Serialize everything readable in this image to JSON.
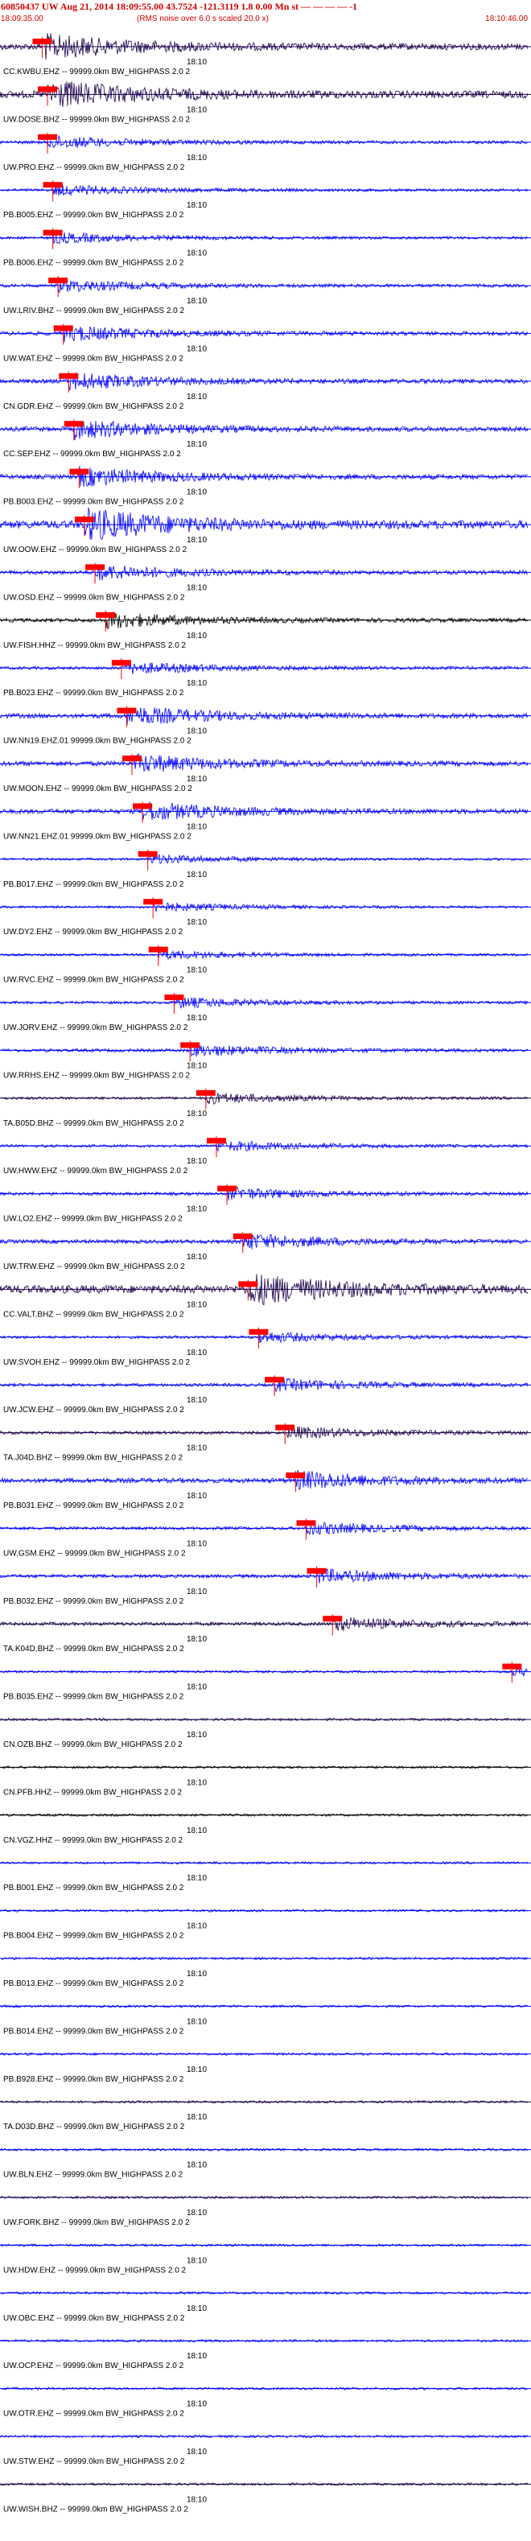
{
  "header": {
    "title": "60850437 UW Aug 21, 2014 18:09:55.00   43.7524 -121.3119   1.8 0.00 Mn st  — — — —   -1",
    "start_time": "18:09:35.00",
    "note": "(RMS noise over 6.0 s scaled 20.0 x)",
    "end_time": "18:10:46.00"
  },
  "colors": {
    "trace_blue": "#0000ff",
    "trace_dark": "#1a004a",
    "trace_black": "#000000",
    "pick_red": "#ff0000",
    "header_red": "#d40000"
  },
  "chart_data": {
    "type": "seismogram",
    "time_label": "18:10",
    "channels": [
      {
        "label": "CC.KWBU.EHZ -- 99999.0km BW_HIGHPASS  2.0  2",
        "color": "#1a004a",
        "pick": 0.08,
        "amp": 0.8
      },
      {
        "label": "UW.DOSE.BHZ -- 99999.0km BW_HIGHPASS  2.0  2",
        "color": "#1a004a",
        "pick": 0.09,
        "amp": 0.9
      },
      {
        "label": "UW.PRO.EHZ -- 99999.0km BW_HIGHPASS  2.0  2",
        "color": "#0000ff",
        "pick": 0.09,
        "amp": 0.4
      },
      {
        "label": "PB.B005.EHZ -- 99999.0km BW_HIGHPASS  2.0  2",
        "color": "#0000ff",
        "pick": 0.1,
        "amp": 0.35
      },
      {
        "label": "PB.B006.EHZ -- 99999.0km BW_HIGHPASS  2.0  2",
        "color": "#0000ff",
        "pick": 0.1,
        "amp": 0.35
      },
      {
        "label": "UW.LRIV.BHZ -- 99999.0km BW_HIGHPASS  2.0  2",
        "color": "#0000ff",
        "pick": 0.11,
        "amp": 0.4
      },
      {
        "label": "UW.WAT.EHZ -- 99999.0km BW_HIGHPASS  2.0  2",
        "color": "#0000ff",
        "pick": 0.12,
        "amp": 0.5
      },
      {
        "label": "CN.GDR.EHZ -- 99999.0km BW_HIGHPASS  2.0  2",
        "color": "#0000ff",
        "pick": 0.13,
        "amp": 0.55
      },
      {
        "label": "CC.SEP.EHZ -- 99999.0km BW_HIGHPASS  2.0  2",
        "color": "#0000ff",
        "pick": 0.14,
        "amp": 0.6
      },
      {
        "label": "PB.B003.EHZ -- 99999.0km BW_HIGHPASS  2.0  2",
        "color": "#0000ff",
        "pick": 0.15,
        "amp": 0.6
      },
      {
        "label": "UW.OOW.EHZ -- 99999.0km BW_HIGHPASS  2.0  2",
        "color": "#0000ff",
        "pick": 0.16,
        "amp": 1.0
      },
      {
        "label": "UW.OSD.EHZ -- 99999.0km BW_HIGHPASS  2.0  2",
        "color": "#0000ff",
        "pick": 0.18,
        "amp": 0.5
      },
      {
        "label": "UW.FISH.HHZ -- 99999.0km BW_HIGHPASS  2.0  2",
        "color": "#000000",
        "pick": 0.2,
        "amp": 0.5
      },
      {
        "label": "PB.B023.EHZ -- 99999.0km BW_HIGHPASS  2.0  2",
        "color": "#0000ff",
        "pick": 0.23,
        "amp": 0.4
      },
      {
        "label": "UW.NN19.EHZ.01 99999.0km BW_HIGHPASS  2.0  2",
        "color": "#0000ff",
        "pick": 0.24,
        "amp": 0.6
      },
      {
        "label": "UW.MOON.EHZ -- 99999.0km BW_HIGHPASS  2.0  2",
        "color": "#0000ff",
        "pick": 0.25,
        "amp": 0.6
      },
      {
        "label": "UW.NN21.EHZ.01 99999.0km BW_HIGHPASS  2.0  2",
        "color": "#0000ff",
        "pick": 0.27,
        "amp": 0.6
      },
      {
        "label": "PB.B017.EHZ -- 99999.0km BW_HIGHPASS  2.0  2",
        "color": "#0000ff",
        "pick": 0.28,
        "amp": 0.3
      },
      {
        "label": "UW.DY2.EHZ -- 99999.0km BW_HIGHPASS  2.0  2",
        "color": "#0000ff",
        "pick": 0.29,
        "amp": 0.3
      },
      {
        "label": "UW.RVC.EHZ -- 99999.0km BW_HIGHPASS  2.0  2",
        "color": "#0000ff",
        "pick": 0.3,
        "amp": 0.3
      },
      {
        "label": "UW.JORV.EHZ -- 99999.0km BW_HIGHPASS  2.0  2",
        "color": "#0000ff",
        "pick": 0.33,
        "amp": 0.35
      },
      {
        "label": "UW.RRHS.EHZ -- 99999.0km BW_HIGHPASS  2.0  2",
        "color": "#0000ff",
        "pick": 0.36,
        "amp": 0.4
      },
      {
        "label": "TA.B05D.BHZ -- 99999.0km BW_HIGHPASS  2.0  2",
        "color": "#1a004a",
        "pick": 0.39,
        "amp": 0.35
      },
      {
        "label": "UW.HWW.EHZ -- 99999.0km BW_HIGHPASS  2.0  2",
        "color": "#0000ff",
        "pick": 0.41,
        "amp": 0.35
      },
      {
        "label": "UW.LO2.EHZ -- 99999.0km BW_HIGHPASS  2.0  2",
        "color": "#0000ff",
        "pick": 0.43,
        "amp": 0.4
      },
      {
        "label": "UW.TRW.EHZ -- 99999.0km BW_HIGHPASS  2.0  2",
        "color": "#0000ff",
        "pick": 0.46,
        "amp": 0.5
      },
      {
        "label": "CC.VALT.BHZ -- 99999.0km BW_HIGHPASS  2.0  2",
        "color": "#1a004a",
        "pick": 0.47,
        "amp": 1.0
      },
      {
        "label": "UW.SVOH.EHZ -- 99999.0km BW_HIGHPASS  2.0  2",
        "color": "#0000ff",
        "pick": 0.49,
        "amp": 0.35
      },
      {
        "label": "UW.JCW.EHZ -- 99999.0km BW_HIGHPASS  2.0  2",
        "color": "#0000ff",
        "pick": 0.52,
        "amp": 0.4
      },
      {
        "label": "TA.J04D.BHZ -- 99999.0km BW_HIGHPASS  2.0  2",
        "color": "#1a004a",
        "pick": 0.54,
        "amp": 0.4
      },
      {
        "label": "PB.B031.EHZ -- 99999.0km BW_HIGHPASS  2.0  2",
        "color": "#0000ff",
        "pick": 0.56,
        "amp": 0.6
      },
      {
        "label": "UW.GSM.EHZ -- 99999.0km BW_HIGHPASS  2.0  2",
        "color": "#0000ff",
        "pick": 0.58,
        "amp": 0.4
      },
      {
        "label": "PB.B032.EHZ -- 99999.0km BW_HIGHPASS  2.0  2",
        "color": "#0000ff",
        "pick": 0.6,
        "amp": 0.45
      },
      {
        "label": "TA.K04D.BHZ -- 99999.0km BW_HIGHPASS  2.0  2",
        "color": "#1a004a",
        "pick": 0.63,
        "amp": 0.45
      },
      {
        "label": "PB.B035.EHZ -- 99999.0km BW_HIGHPASS  2.0  2",
        "color": "#0000ff",
        "pick": 0.97,
        "amp": 0.3
      },
      {
        "label": "CN.OZB.BHZ -- 99999.0km BW_HIGHPASS  2.0  2",
        "color": "#1a004a",
        "pick": null,
        "amp": 0.3
      },
      {
        "label": "CN.PFB.HHZ -- 99999.0km BW_HIGHPASS  2.0  2",
        "color": "#000000",
        "pick": null,
        "amp": 0.3
      },
      {
        "label": "CN.VGZ.HHZ -- 99999.0km BW_HIGHPASS  2.0  2",
        "color": "#000000",
        "pick": null,
        "amp": 0.3
      },
      {
        "label": "PB.B001.EHZ -- 99999.0km BW_HIGHPASS  2.0  2",
        "color": "#0000ff",
        "pick": null,
        "amp": 0.3
      },
      {
        "label": "PB.B004.EHZ -- 99999.0km BW_HIGHPASS  2.0  2",
        "color": "#0000ff",
        "pick": null,
        "amp": 0.3
      },
      {
        "label": "PB.B013.EHZ -- 99999.0km BW_HIGHPASS  2.0  2",
        "color": "#0000ff",
        "pick": null,
        "amp": 0.3
      },
      {
        "label": "PB.B014.EHZ -- 99999.0km BW_HIGHPASS  2.0  2",
        "color": "#0000ff",
        "pick": null,
        "amp": 0.3
      },
      {
        "label": "PB.B928.EHZ -- 99999.0km BW_HIGHPASS  2.0  2",
        "color": "#0000ff",
        "pick": null,
        "amp": 0.3
      },
      {
        "label": "TA.D03D.BHZ -- 99999.0km BW_HIGHPASS  2.0  2",
        "color": "#1a004a",
        "pick": null,
        "amp": 0.3
      },
      {
        "label": "UW.BLN.EHZ -- 99999.0km BW_HIGHPASS  2.0  2",
        "color": "#0000ff",
        "pick": null,
        "amp": 0.3
      },
      {
        "label": "UW.FORK.BHZ -- 99999.0km BW_HIGHPASS  2.0  2",
        "color": "#1a004a",
        "pick": null,
        "amp": 0.3
      },
      {
        "label": "UW.HDW.EHZ -- 99999.0km BW_HIGHPASS  2.0  2",
        "color": "#0000ff",
        "pick": null,
        "amp": 0.3
      },
      {
        "label": "UW.OBC.EHZ -- 99999.0km BW_HIGHPASS  2.0  2",
        "color": "#0000ff",
        "pick": null,
        "amp": 0.3
      },
      {
        "label": "UW.OCP.EHZ -- 99999.0km BW_HIGHPASS  2.0  2",
        "color": "#0000ff",
        "pick": null,
        "amp": 0.3
      },
      {
        "label": "UW.OTR.EHZ -- 99999.0km BW_HIGHPASS  2.0  2",
        "color": "#0000ff",
        "pick": null,
        "amp": 0.3
      },
      {
        "label": "UW.STW.EHZ -- 99999.0km BW_HIGHPASS  2.0  2",
        "color": "#0000ff",
        "pick": null,
        "amp": 0.3
      },
      {
        "label": "UW.WISH.BHZ -- 99999.0km BW_HIGHPASS  2.0  2",
        "color": "#1a004a",
        "pick": null,
        "amp": 0.3
      }
    ]
  }
}
